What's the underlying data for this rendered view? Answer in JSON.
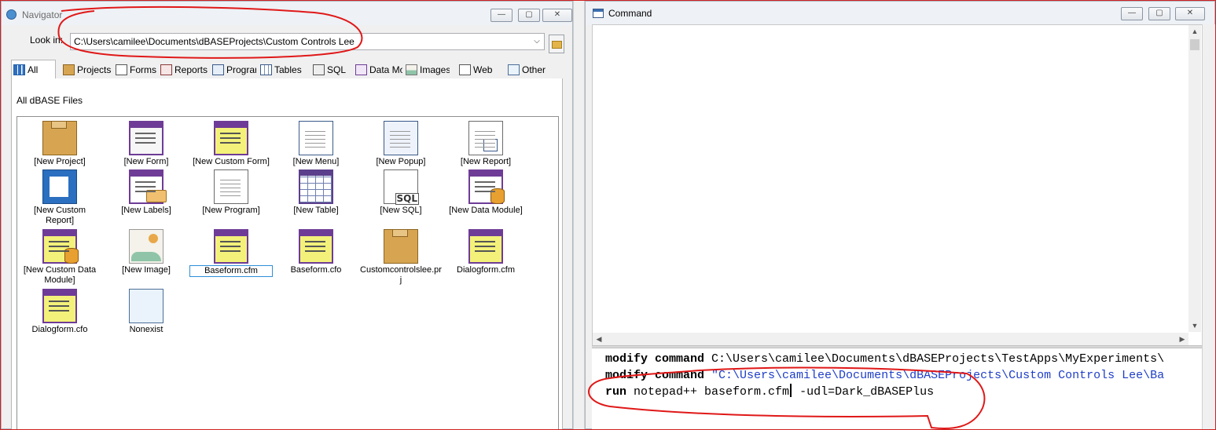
{
  "navigator": {
    "title": "Navigator",
    "look_in_label": "Look in:",
    "look_in_value": "C:\\Users\\camilee\\Documents\\dBASEProjects\\Custom Controls Lee",
    "window_buttons": {
      "minimize": "—",
      "maximize": "▢",
      "close": "✕"
    },
    "tabs": [
      {
        "label": "All",
        "icon": "all-files-icon",
        "active": true
      },
      {
        "label": "Projects",
        "icon": "projects-icon"
      },
      {
        "label": "Forms",
        "icon": "forms-icon"
      },
      {
        "label": "Reports",
        "icon": "reports-icon"
      },
      {
        "label": "Programs",
        "icon": "programs-icon"
      },
      {
        "label": "Tables",
        "icon": "tables-icon"
      },
      {
        "label": "SQL",
        "icon": "sql-icon"
      },
      {
        "label": "Data Modules",
        "icon": "data-modules-icon"
      },
      {
        "label": "Images",
        "icon": "images-icon"
      },
      {
        "label": "Web",
        "icon": "web-icon"
      },
      {
        "label": "Other",
        "icon": "other-icon"
      }
    ],
    "panel_caption": "All dBASE Files",
    "files": [
      {
        "label": "[New Project]",
        "icon": "project-box-icon"
      },
      {
        "label": "[New Form]",
        "icon": "form-icon"
      },
      {
        "label": "[New Custom Form]",
        "icon": "custom-form-icon"
      },
      {
        "label": "[New Menu]",
        "icon": "menu-icon"
      },
      {
        "label": "[New Popup]",
        "icon": "popup-icon"
      },
      {
        "label": "[New Report]",
        "icon": "report-icon"
      },
      {
        "label": "[New Custom Report]",
        "icon": "custom-report-icon"
      },
      {
        "label": "[New Labels]",
        "icon": "labels-icon"
      },
      {
        "label": "[New Program]",
        "icon": "program-icon"
      },
      {
        "label": "[New Table]",
        "icon": "table-icon"
      },
      {
        "label": "[New SQL]",
        "icon": "sql-file-icon"
      },
      {
        "label": "[New Data Module]",
        "icon": "data-module-icon"
      },
      {
        "label": "[New Custom Data Module]",
        "icon": "custom-data-module-icon"
      },
      {
        "label": "[New Image]",
        "icon": "image-icon"
      },
      {
        "label": "Baseform.cfm",
        "icon": "custom-form-icon",
        "selected": true
      },
      {
        "label": "Baseform.cfo",
        "icon": "custom-form-icon"
      },
      {
        "label": "Customcontrolslee.prj",
        "icon": "project-box-icon"
      },
      {
        "label": "Dialogform.cfm",
        "icon": "custom-form-icon"
      },
      {
        "label": "Dialogform.cfo",
        "icon": "custom-form-icon"
      },
      {
        "label": "Nonexist",
        "icon": "blank-file-icon"
      }
    ]
  },
  "command": {
    "title": "Command",
    "lines": [
      {
        "kw": "modify command",
        "rest": " C:\\Users\\camilee\\Documents\\dBASEProjects\\TestApps\\MyExperiments\\"
      },
      {
        "kw": "modify command",
        "str": " \"C:\\Users\\camilee\\Documents\\dBASEProjects\\Custom Controls Lee\\Ba"
      },
      {
        "kw": "run",
        "before_cursor": " notepad++ baseform.cfm",
        "after_cursor": " -udl=Dark_dBASEPlus"
      }
    ]
  },
  "colors": {
    "annotation": "#e01818",
    "selection": "#2f8fd8",
    "string": "#1f3ec8"
  }
}
